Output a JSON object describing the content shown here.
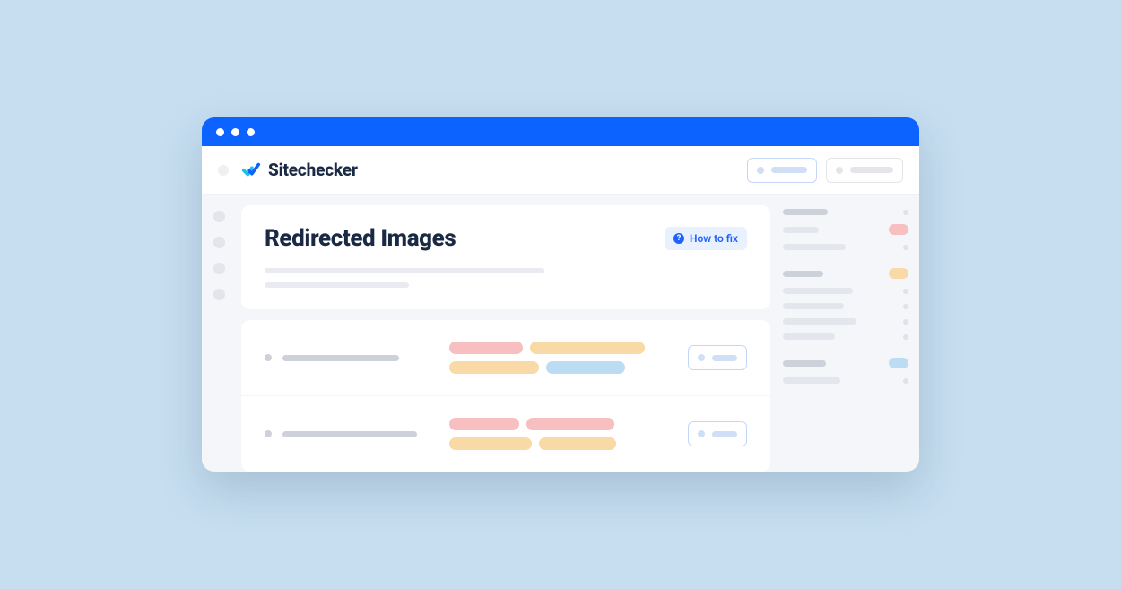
{
  "branding": {
    "name": "Sitechecker"
  },
  "page": {
    "title": "Redirected Images",
    "how_to_fix_label": "How to fix"
  },
  "colors": {
    "accent": "#0d63ff",
    "background": "#c6def0",
    "tag_red": "#f7bfbf",
    "tag_orange": "#f9d9a6",
    "tag_blue": "#bcdcf3"
  }
}
